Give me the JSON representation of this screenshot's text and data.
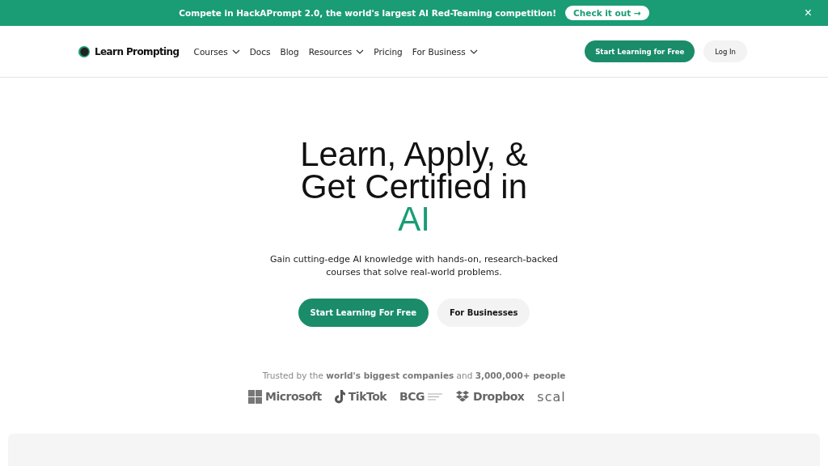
{
  "banner": {
    "text": "Compete in HackAPrompt 2.0, the world's largest AI Red-Teaming competition!",
    "button": "Check it out →",
    "close": "×"
  },
  "nav": {
    "logo": "Learn Prompting",
    "items": [
      {
        "label": "Courses",
        "dropdown": true
      },
      {
        "label": "Docs",
        "dropdown": false
      },
      {
        "label": "Blog",
        "dropdown": false
      },
      {
        "label": "Resources",
        "dropdown": true
      },
      {
        "label": "Pricing",
        "dropdown": false
      },
      {
        "label": "For Business",
        "dropdown": true
      }
    ],
    "primary_button": "Start Learning for Free",
    "login_button": "Log In"
  },
  "hero": {
    "title_lines": [
      "Learn, Apply, &",
      "Get Certified in"
    ],
    "title_highlight": "AI",
    "subtitle": "Gain cutting-edge AI knowledge with hands-on, research-backed courses that solve real-world problems.",
    "primary_button": "Start Learning For Free",
    "secondary_button": "For Businesses"
  },
  "trusted": {
    "text": "Trusted by the **world's biggest companies** and **3,000,000+ people**",
    "logos": [
      {
        "kind": "microsoft",
        "name": "Microsoft"
      },
      {
        "kind": "tiktok",
        "name": "TikTok"
      },
      {
        "kind": "bcg",
        "name": "BCG"
      },
      {
        "kind": "dropbox",
        "name": "Dropbox"
      },
      {
        "kind": "plain",
        "name": "scal"
      }
    ]
  }
}
